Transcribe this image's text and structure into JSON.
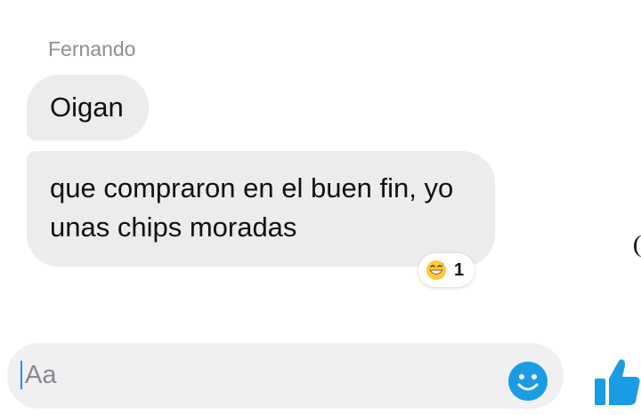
{
  "conversation": {
    "sender_name": "Fernando",
    "messages": [
      {
        "text": "Oigan"
      },
      {
        "text": "que compraron en el buen fin, yo unas chips moradas"
      }
    ],
    "reaction": {
      "emoji": "grinning-sweat-face-icon",
      "count": "1"
    }
  },
  "composer": {
    "placeholder": "Aa",
    "value": "",
    "emoji_button_icon": "smiley-icon",
    "like_button_icon": "thumbs-up-icon"
  },
  "colors": {
    "accent": "#1a9be6",
    "bubble_background": "#ececee",
    "composer_background": "#f0f0f3"
  }
}
